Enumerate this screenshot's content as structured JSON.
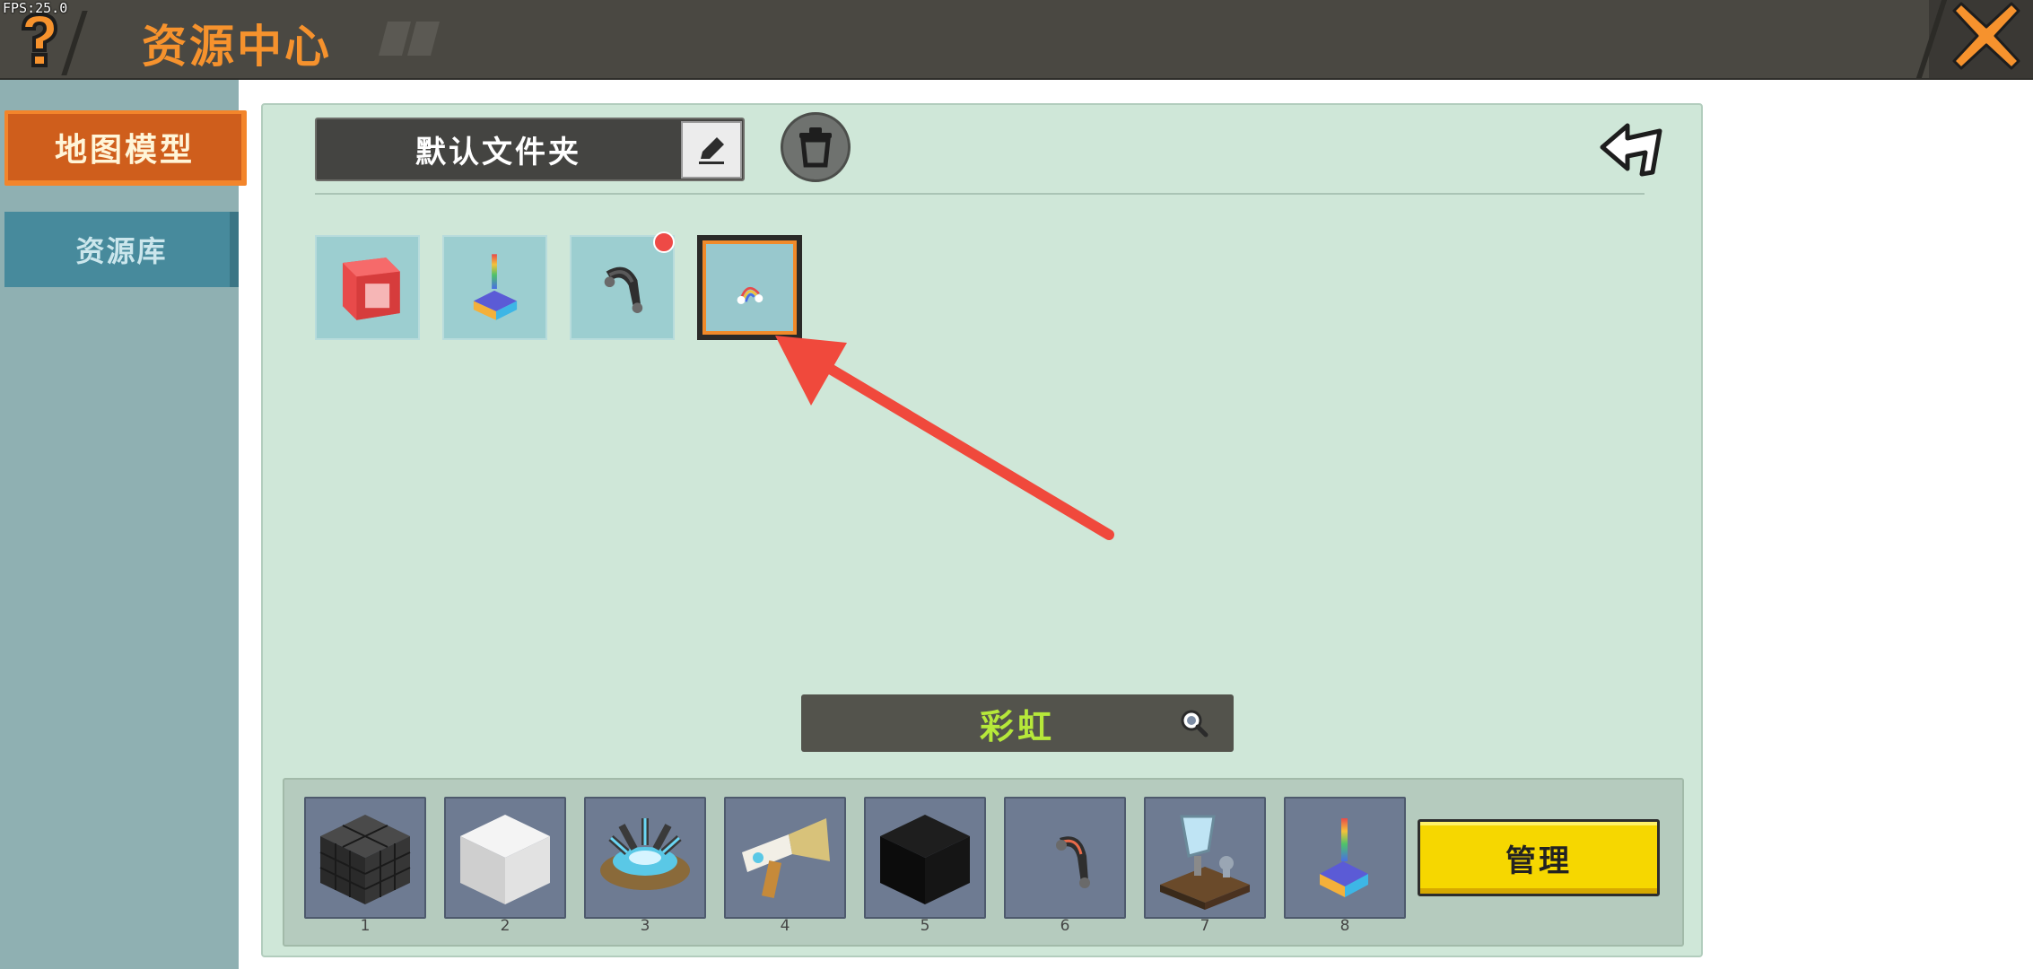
{
  "fps": "FPS:25.0",
  "header": {
    "title": "资源中心"
  },
  "sidebar": {
    "tabs": [
      {
        "label": "地图模型",
        "active": true
      },
      {
        "label": "资源库",
        "active": false
      }
    ]
  },
  "folder": {
    "name": "默认文件夹"
  },
  "items": [
    {
      "icon": "red-block-icon"
    },
    {
      "icon": "rainbow-lamp-icon"
    },
    {
      "icon": "rainbow-arc-dark-icon",
      "badge": true
    },
    {
      "icon": "rainbow-small-icon",
      "selected": true
    }
  ],
  "search": {
    "query": "彩虹"
  },
  "hotbar": {
    "slots": [
      {
        "number": "1",
        "icon": "dark-stone-block-icon"
      },
      {
        "number": "2",
        "icon": "white-wool-block-icon"
      },
      {
        "number": "3",
        "icon": "tech-device-icon"
      },
      {
        "number": "4",
        "icon": "horn-blaster-icon"
      },
      {
        "number": "5",
        "icon": "black-block-icon"
      },
      {
        "number": "6",
        "icon": "rainbow-arc-icon"
      },
      {
        "number": "7",
        "icon": "alchemy-table-icon"
      },
      {
        "number": "8",
        "icon": "rainbow-lamp-icon"
      }
    ],
    "manage_label": "管理"
  },
  "colors": {
    "accent_orange": "#f6922d",
    "topbar": "#4a4842",
    "panel": "#cfe7d8",
    "search_text": "#b6e83a",
    "manage_button": "#f6d700",
    "annotation_arrow": "#f0493c"
  }
}
